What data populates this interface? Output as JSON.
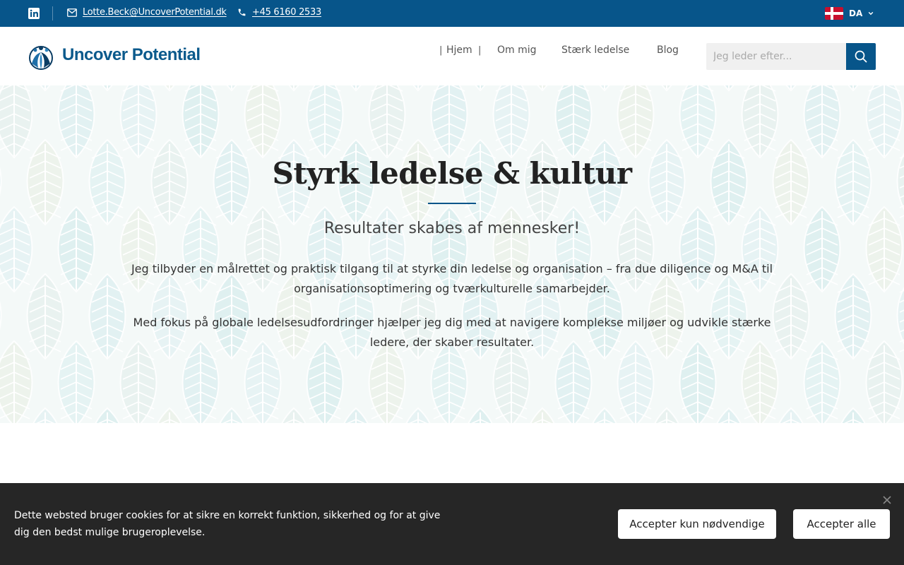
{
  "topbar": {
    "linkedin_icon": "linkedin-icon",
    "email": "Lotte.Beck@UncoverPotential.dk",
    "phone": "+45 6160 2533",
    "language": "DA",
    "language_flag": "denmark-flag-icon"
  },
  "header": {
    "logo_text": "Uncover Potential",
    "nav": [
      "Hjem",
      "Om mig",
      "Stærk ledelse",
      "Blog"
    ],
    "search_placeholder": "Jeg leder efter..."
  },
  "hero": {
    "title": "Styrk ledelse & kultur",
    "subtitle": "Resultater skabes af mennesker!",
    "paragraph1": "Jeg tilbyder en målrettet og praktisk tilgang til at styrke din ledelse og organisation – fra due diligence og M&A til organisationsoptimering og tværkulturelle samarbejder.",
    "paragraph2": "Med fokus på globale ledelsesudfordringer hjælper jeg dig med at navigere komplekse miljøer og udvikle stærke ledere, der skaber resultater."
  },
  "cookie": {
    "text": "Dette websted bruger cookies for at sikre en korrekt funktion, sikkerhed og for at give dig den bedst mulige brugeroplevelse.",
    "button_necessary": "Accepter kun nødvendige",
    "button_all": "Accepter alle"
  },
  "colors": {
    "primary": "#07558a",
    "cookie_bg": "#262626",
    "hero_bg": "#eef6f5"
  }
}
